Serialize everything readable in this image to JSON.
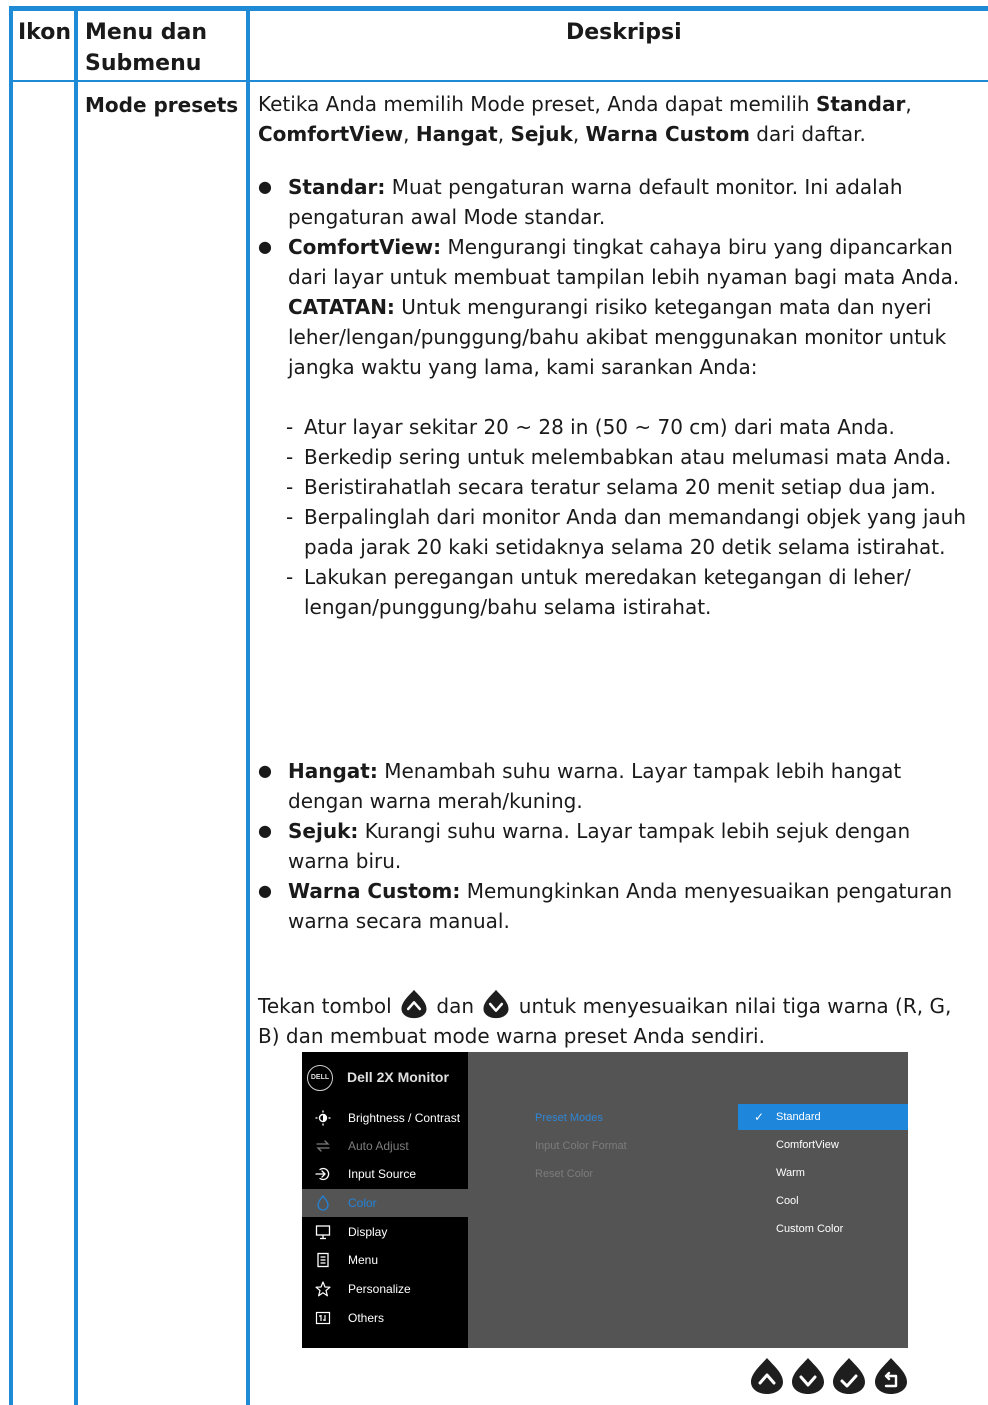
{
  "table": {
    "header": {
      "icon": "Ikon",
      "menu": "Menu dan Submenu",
      "description": "Deskripsi"
    },
    "row": {
      "menu_name": "Mode presets",
      "intro": {
        "t1": "Ketika Anda memilih Mode preset, Anda dapat memilih ",
        "standar": "Standar",
        "comma": ", ",
        "comfortview": "ComfortView",
        "hangat": "Hangat",
        "sejuk": "Sejuk",
        "warna_custom": "Warna Custom",
        "t2": " dari daftar."
      },
      "bullets": [
        {
          "term": "Standar:",
          "text": " Muat pengaturan warna default monitor. Ini adalah pengaturan awal Mode standar."
        },
        {
          "term": "ComfortView:",
          "text": " Mengurangi tingkat cahaya biru yang dipancarkan dari layar untuk membuat tampilan lebih nyaman bagi mata Anda.",
          "note_term": "CATATAN:",
          "note_text": " Untuk mengurangi risiko ketegangan mata dan nyeri leher/lengan/punggung/bahu akibat menggunakan monitor untuk jangka waktu yang lama, kami sarankan Anda:"
        },
        {
          "term": "Hangat:",
          "text": " Menambah suhu warna. Layar tampak lebih hangat dengan warna merah/kuning."
        },
        {
          "term": "Sejuk:",
          "text": " Kurangi suhu warna. Layar tampak lebih sejuk dengan warna biru."
        },
        {
          "term": "Warna Custom:",
          "text": " Memungkinkan Anda menyesuaikan pengaturan warna secara manual."
        }
      ],
      "tips": [
        "Atur layar sekitar 20 ~ 28 in (50 ~ 70 cm) dari mata Anda.",
        "Berkedip sering untuk melembabkan atau melumasi mata Anda.",
        "Beristirahatlah secara teratur selama 20 menit setiap dua jam.",
        "Berpalinglah dari monitor Anda dan memandangi objek yang jauh pada jarak 20 kaki setidaknya selama 20 detik selama istirahat.",
        "Lakukan peregangan untuk meredakan ketegangan di leher/ lengan/punggung/bahu selama istirahat."
      ],
      "press": {
        "t1": "Tekan tombol ",
        "t2": " dan ",
        "t3": " untuk menyesuaikan nilai tiga warna (R, G, B) dan membuat mode warna preset Anda sendiri."
      }
    }
  },
  "osd": {
    "logo": "DELL",
    "title": "Dell 2X Monitor",
    "menu_items": [
      {
        "label": "Brightness / Contrast",
        "icon": "brightness-icon"
      },
      {
        "label": "Auto Adjust",
        "icon": "auto-adjust-icon"
      },
      {
        "label": "Input Source",
        "icon": "input-source-icon"
      },
      {
        "label": "Color",
        "icon": "color-icon"
      },
      {
        "label": "Display",
        "icon": "display-icon"
      },
      {
        "label": "Menu",
        "icon": "menu-icon"
      },
      {
        "label": "Personalize",
        "icon": "star-icon"
      },
      {
        "label": "Others",
        "icon": "others-icon"
      }
    ],
    "submenu": [
      "Preset Modes",
      "Input Color Format",
      "Reset Color"
    ],
    "options": [
      "Standard",
      "ComfortView",
      "Warm",
      "Cool",
      "Custom Color"
    ],
    "selected_option": "Standard",
    "check": "✓"
  },
  "buttons": [
    "up-button",
    "down-button",
    "ok-button",
    "back-button"
  ],
  "colors": {
    "rule": "#1f8ad6",
    "osd_bg": "#545454",
    "osd_left": "#000000",
    "accent": "#1e86db"
  }
}
